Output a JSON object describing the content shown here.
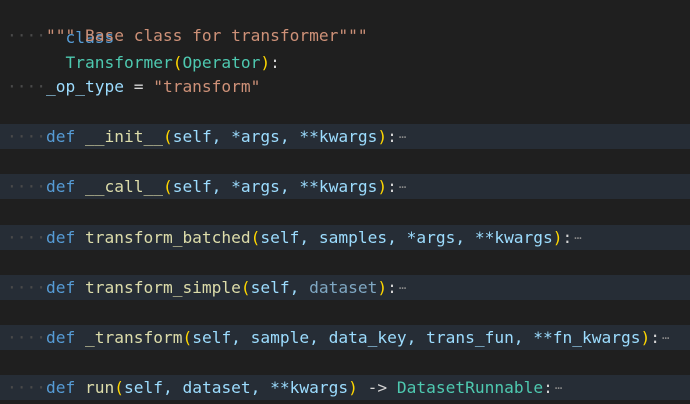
{
  "editor": {
    "lines": {
      "l1": {
        "kw": "class",
        "cls": "Transformer",
        "open": "(",
        "base": "Operator",
        "close": ")",
        "colon": ":"
      },
      "l2": {
        "indent": "····",
        "doc": "\"\"\" Base class for transformer\"\"\""
      },
      "l3": {
        "indent": "····",
        "var": "_op_type",
        "eq": " = ",
        "str": "\"transform\""
      },
      "l4": {
        "indent": "····",
        "kw": "def",
        "fn": "__init__",
        "open": "(",
        "params": "self, *args, **kwargs",
        "close": ")",
        "colon": ":",
        "ellipsis": "⋯"
      },
      "l5": {
        "indent": "····",
        "kw": "def",
        "fn": "__call__",
        "open": "(",
        "params": "self, *args, **kwargs",
        "close": ")",
        "colon": ":",
        "ellipsis": "⋯"
      },
      "l6": {
        "indent": "····",
        "kw": "def",
        "fn": "transform_batched",
        "open": "(",
        "params": "self, samples, *args, **kwargs",
        "close": ")",
        "colon": ":",
        "ellipsis": "⋯"
      },
      "l7": {
        "indent": "····",
        "kw": "def",
        "fn": "transform_simple",
        "open": "(",
        "p1": "self, ",
        "p2": "dataset",
        "close": ")",
        "colon": ":",
        "ellipsis": "⋯"
      },
      "l8": {
        "indent": "····",
        "kw": "def",
        "fn": "_transform",
        "open": "(",
        "params": "self, sample, data_key, trans_fun, **fn_kwargs",
        "close": ")",
        "colon": ":",
        "ellipsis": "⋯"
      },
      "l9": {
        "indent": "····",
        "kw": "def",
        "fn": "run",
        "open": "(",
        "params": "self, dataset, **kwargs",
        "close": ")",
        "arrow": " -> ",
        "ret": "DatasetRunnable",
        "colon": ":",
        "ellipsis": "⋯"
      }
    }
  }
}
